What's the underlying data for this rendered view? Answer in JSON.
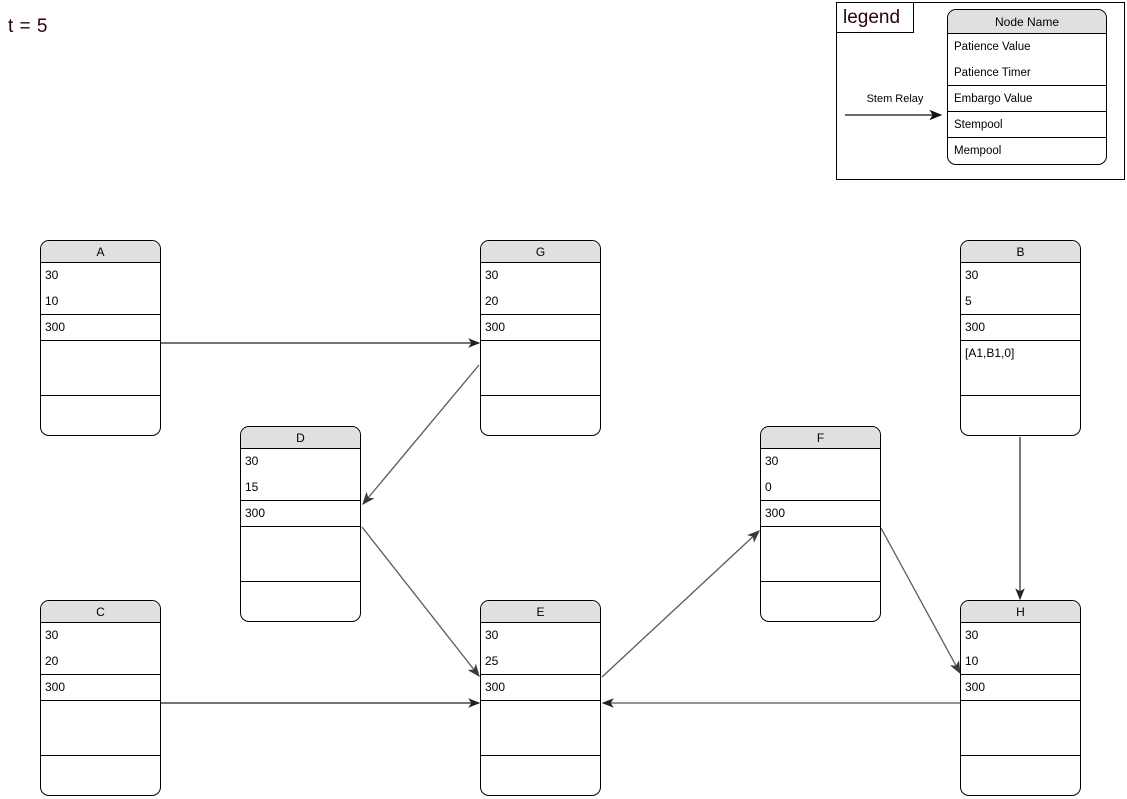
{
  "diagram": {
    "time_label": "t = 5",
    "title_color": "#2b0011",
    "header_fill": "#e0e0e0",
    "edge_color": "#555555"
  },
  "legend": {
    "title": "legend",
    "stem_relay_label": "Stem Relay",
    "node_name_header": "Node Name",
    "fields": [
      "Patience Value",
      "Patience Timer",
      "Embargo Value",
      "Stempool",
      "Mempool"
    ]
  },
  "nodes": [
    {
      "id": "A",
      "name": "A",
      "patience_value": "30",
      "patience_timer": "10",
      "embargo_value": "300",
      "stempool": "",
      "mempool": ""
    },
    {
      "id": "G",
      "name": "G",
      "patience_value": "30",
      "patience_timer": "20",
      "embargo_value": "300",
      "stempool": "",
      "mempool": ""
    },
    {
      "id": "B",
      "name": "B",
      "patience_value": "30",
      "patience_timer": "5",
      "embargo_value": "300",
      "stempool": "[A1,B1,0]",
      "mempool": ""
    },
    {
      "id": "D",
      "name": "D",
      "patience_value": "30",
      "patience_timer": "15",
      "embargo_value": "300",
      "stempool": "",
      "mempool": ""
    },
    {
      "id": "F",
      "name": "F",
      "patience_value": "30",
      "patience_timer": "0",
      "embargo_value": "300",
      "stempool": "",
      "mempool": ""
    },
    {
      "id": "C",
      "name": "C",
      "patience_value": "30",
      "patience_timer": "20",
      "embargo_value": "300",
      "stempool": "",
      "mempool": ""
    },
    {
      "id": "E",
      "name": "E",
      "patience_value": "30",
      "patience_timer": "25",
      "embargo_value": "300",
      "stempool": "",
      "mempool": ""
    },
    {
      "id": "H",
      "name": "H",
      "patience_value": "30",
      "patience_timer": "10",
      "embargo_value": "300",
      "stempool": "",
      "mempool": ""
    }
  ],
  "edges": [
    {
      "from": "A",
      "to": "G"
    },
    {
      "from": "G",
      "to": "D"
    },
    {
      "from": "D",
      "to": "E"
    },
    {
      "from": "C",
      "to": "E"
    },
    {
      "from": "E",
      "to": "F"
    },
    {
      "from": "F",
      "to": "H"
    },
    {
      "from": "B",
      "to": "H"
    },
    {
      "from": "H",
      "to": "E"
    }
  ]
}
